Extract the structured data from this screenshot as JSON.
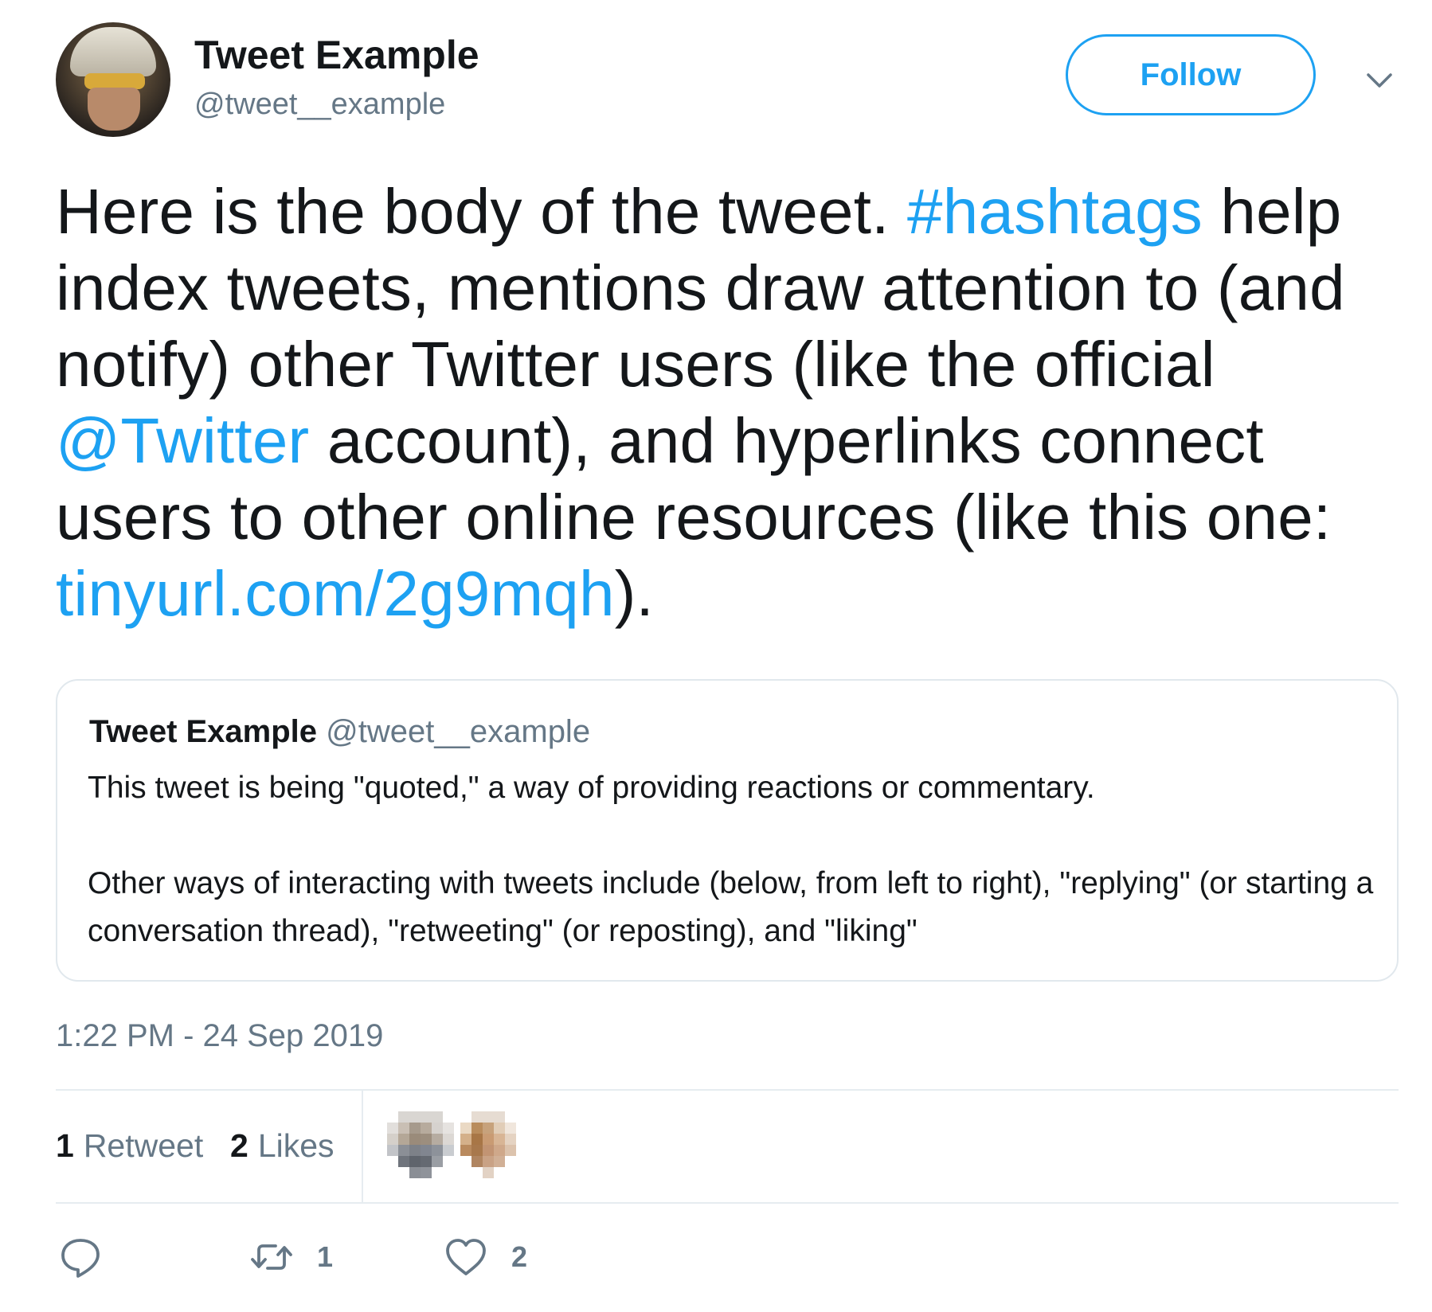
{
  "author": {
    "display_name": "Tweet Example",
    "handle": "@tweet__example"
  },
  "follow_button": {
    "label": "Follow"
  },
  "tweet": {
    "segments": [
      {
        "text": "Here is the body of the tweet. ",
        "type": "text"
      },
      {
        "text": "#hashtags",
        "type": "hashtag"
      },
      {
        "text": " help index tweets, mentions draw attention to (and notify) other Twitter users (like the official ",
        "type": "text"
      },
      {
        "text": "@Twitter",
        "type": "mention"
      },
      {
        "text": " account), and hyperlinks connect users to other online resources (like this one: ",
        "type": "text"
      },
      {
        "text": "tinyurl.com/2g9mqh",
        "type": "url"
      },
      {
        "text": ").",
        "type": "text"
      }
    ]
  },
  "quoted_tweet": {
    "display_name": "Tweet Example",
    "handle": "@tweet__example",
    "paragraph_1": "This tweet is being \"quoted,\" a way of providing reactions or commentary.",
    "paragraph_2": "Other ways of interacting with tweets include (below, from left to right), \"replying\" (or starting a conversation thread), \"retweeting\" (or reposting), and \"liking\""
  },
  "timestamp": "1:22 PM - 24 Sep 2019",
  "stats": {
    "retweets_count": "1",
    "retweets_label": "Retweet",
    "likes_count": "2",
    "likes_label": "Likes"
  },
  "actions": {
    "reply_icon": "reply-bubble-icon",
    "retweet_icon": "retweet-arrows-icon",
    "retweet_count": "1",
    "like_icon": "heart-icon",
    "like_count": "2"
  },
  "colors": {
    "link": "#1da1f2",
    "text": "#14171a",
    "secondary": "#657786",
    "border": "#e1e8ed"
  }
}
